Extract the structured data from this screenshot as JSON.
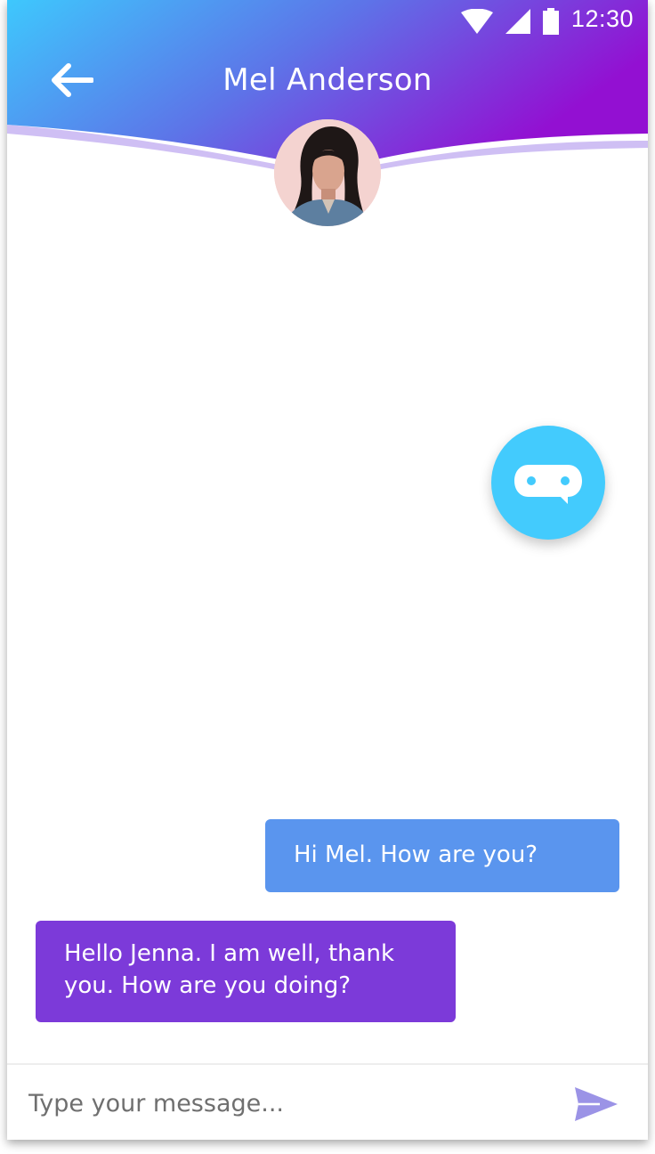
{
  "status_bar": {
    "time": "12:30",
    "icons": [
      "wifi-icon",
      "signal-icon",
      "battery-icon"
    ]
  },
  "header": {
    "title": "Mel Anderson",
    "back_icon": "arrow-left-icon",
    "avatar_icon": "contact-avatar"
  },
  "fab": {
    "icon": "chat-bot-icon"
  },
  "messages": [
    {
      "direction": "outgoing",
      "text": "Hi Mel. How are you?"
    },
    {
      "direction": "incoming",
      "text": "Hello Jenna. I am well, thank you. How are you doing?"
    }
  ],
  "composer": {
    "placeholder": "Type your message...",
    "value": "",
    "send_icon": "send-icon"
  },
  "colors": {
    "gradient_start": "#3ec8fd",
    "gradient_end": "#9310d2",
    "outgoing_bubble": "#5a95ee",
    "incoming_bubble": "#7c3ad9",
    "fab": "#43cbfd",
    "send_icon": "#9b93e6"
  }
}
